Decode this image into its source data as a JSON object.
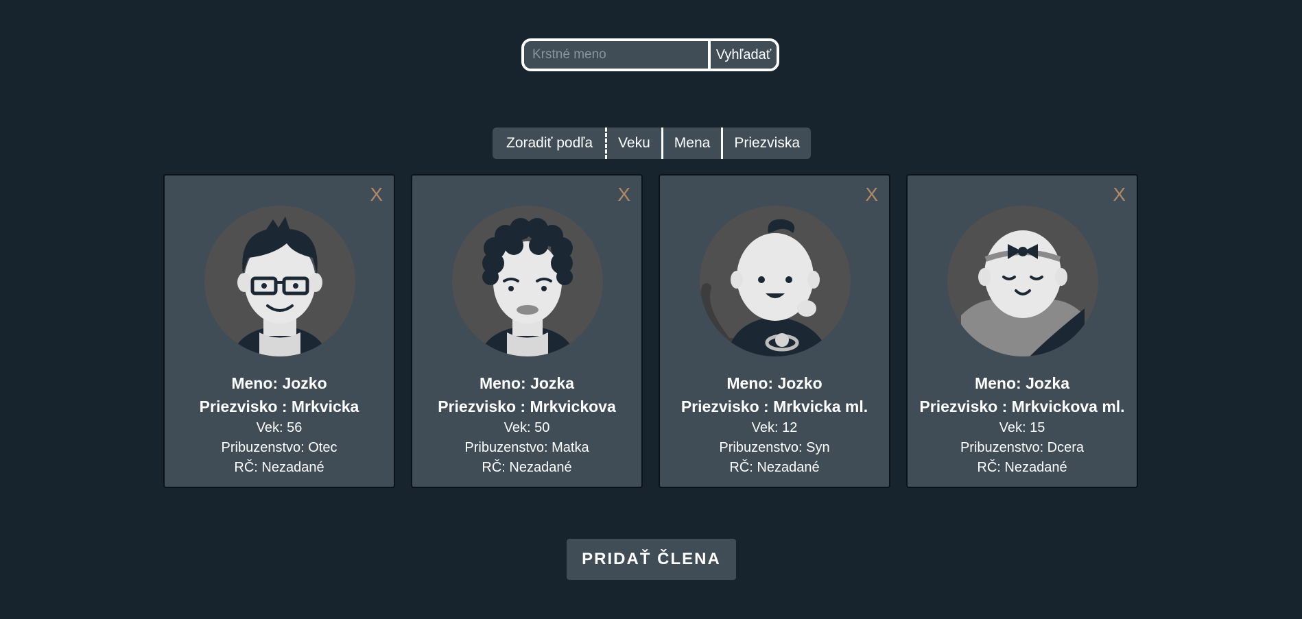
{
  "search": {
    "placeholder": "Krstné meno",
    "button_label": "Vyhľadať"
  },
  "sort": {
    "label": "Zoradiť podľa",
    "options": [
      "Veku",
      "Mena",
      "Priezviska"
    ]
  },
  "members": [
    {
      "close": "X",
      "name_line": "Meno: Jozko",
      "surname_line": "Priezvisko : Mrkvicka",
      "age_line": "Vek: 56",
      "relation_line": "Pribuzenstvo: Otec",
      "rc_line": "RČ: Nezadané",
      "avatar": "man-with-glasses-avatar"
    },
    {
      "close": "X",
      "name_line": "Meno: Jozka",
      "surname_line": "Priezvisko : Mrkvickova",
      "age_line": "Vek: 50",
      "relation_line": "Pribuzenstvo: Matka",
      "rc_line": "RČ: Nezadané",
      "avatar": "woman-curly-hair-avatar"
    },
    {
      "close": "X",
      "name_line": "Meno: Jozko",
      "surname_line": "Priezvisko : Mrkvicka ml.",
      "age_line": "Vek: 12",
      "relation_line": "Pribuzenstvo: Syn",
      "rc_line": "RČ: Nezadané",
      "avatar": "baby-boy-avatar"
    },
    {
      "close": "X",
      "name_line": "Meno: Jozka",
      "surname_line": "Priezvisko : Mrkvickova ml.",
      "age_line": "Vek: 15",
      "relation_line": "Pribuzenstvo: Dcera",
      "rc_line": "RČ: Nezadané",
      "avatar": "baby-girl-bow-avatar"
    }
  ],
  "add_button": "PRIDAŤ  ČLENA",
  "colors": {
    "background": "#17232d",
    "panel": "#404d57",
    "close_x": "#b08a68",
    "avatar_circle": "#505050"
  }
}
